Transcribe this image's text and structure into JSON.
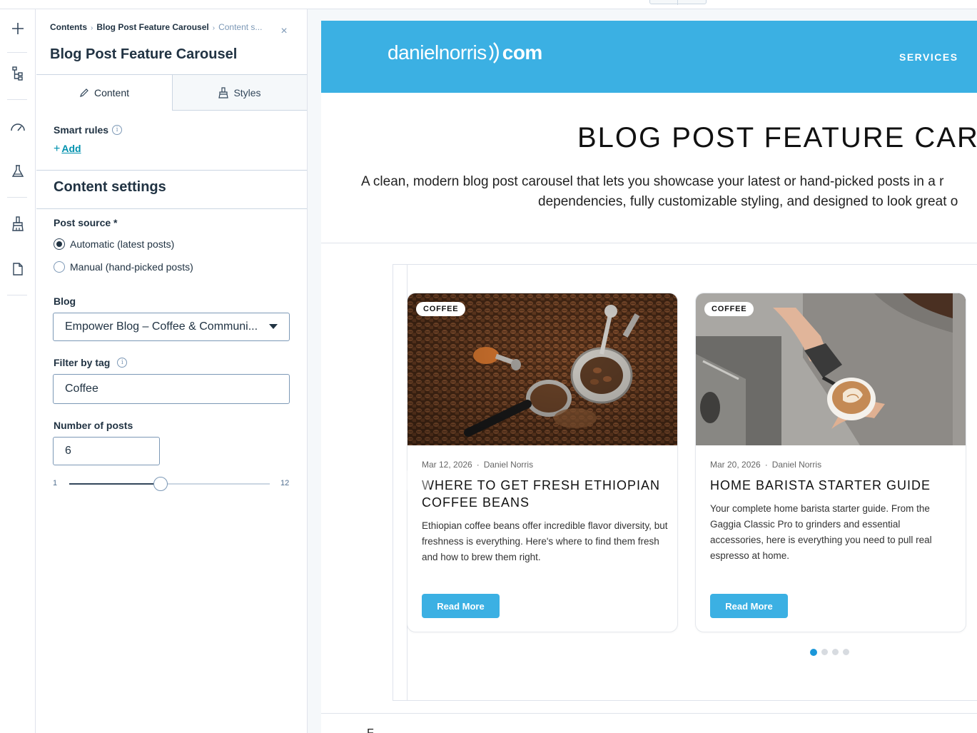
{
  "breadcrumb": {
    "root": "Contents",
    "module": "Blog Post Feature Carousel",
    "current": "Content s..."
  },
  "panel": {
    "title": "Blog Post Feature Carousel",
    "tabs": [
      {
        "label": "Content",
        "icon": "pencil-icon",
        "active": true
      },
      {
        "label": "Styles",
        "icon": "brush-icon",
        "active": false
      }
    ],
    "smart_rules": {
      "label": "Smart rules",
      "add_label": "Add"
    },
    "section_title": "Content settings",
    "post_source": {
      "label": "Post source *",
      "options": [
        {
          "label": "Automatic (latest posts)",
          "selected": true
        },
        {
          "label": "Manual (hand-picked posts)",
          "selected": false
        }
      ]
    },
    "blog": {
      "label": "Blog",
      "value": "Empower Blog – Coffee & Communi..."
    },
    "filter_tag": {
      "label": "Filter by tag",
      "value": "Coffee"
    },
    "num_posts": {
      "label": "Number of posts",
      "value": "6",
      "min_label": "1",
      "max_label": "12",
      "min": 1,
      "max": 12,
      "current": 6
    }
  },
  "rail_icons": [
    "plus-icon",
    "tree-icon",
    "gauge-icon",
    "flask-icon",
    "brush-icon",
    "page-icon"
  ],
  "site": {
    "logo_name": "danielnorris",
    "logo_domain": "com",
    "nav_services": "SERVICES",
    "header_color": "#3bb0e3"
  },
  "hero": {
    "title": "BLOG POST FEATURE CAR",
    "line1": "A clean, modern blog post carousel that lets you showcase your latest or hand-picked posts in a r",
    "line2": "dependencies, fully customizable styling, and designed to look great o"
  },
  "cards": [
    {
      "badge": "COFFEE",
      "date": "Mar 12, 2026",
      "author": "Daniel Norris",
      "title": "WHERE TO GET FRESH ETHIOPIAN COFFEE BEANS",
      "excerpt": "Ethiopian coffee beans offer incredible flavor diversity, but freshness is everything. Here's where to find them fresh and how to brew them right.",
      "button": "Read More"
    },
    {
      "badge": "COFFEE",
      "date": "Mar 20, 2026",
      "author": "Daniel Norris",
      "title": "HOME BARISTA STARTER GUIDE",
      "excerpt": "Your complete home barista starter guide. From the Gaggia Classic Pro to grinders and essential accessories, here is everything you need to pull real espresso at home.",
      "button": "Read More"
    }
  ],
  "pagination": {
    "total": 4,
    "active_index": 0
  },
  "separator": "·",
  "below_text": "F"
}
